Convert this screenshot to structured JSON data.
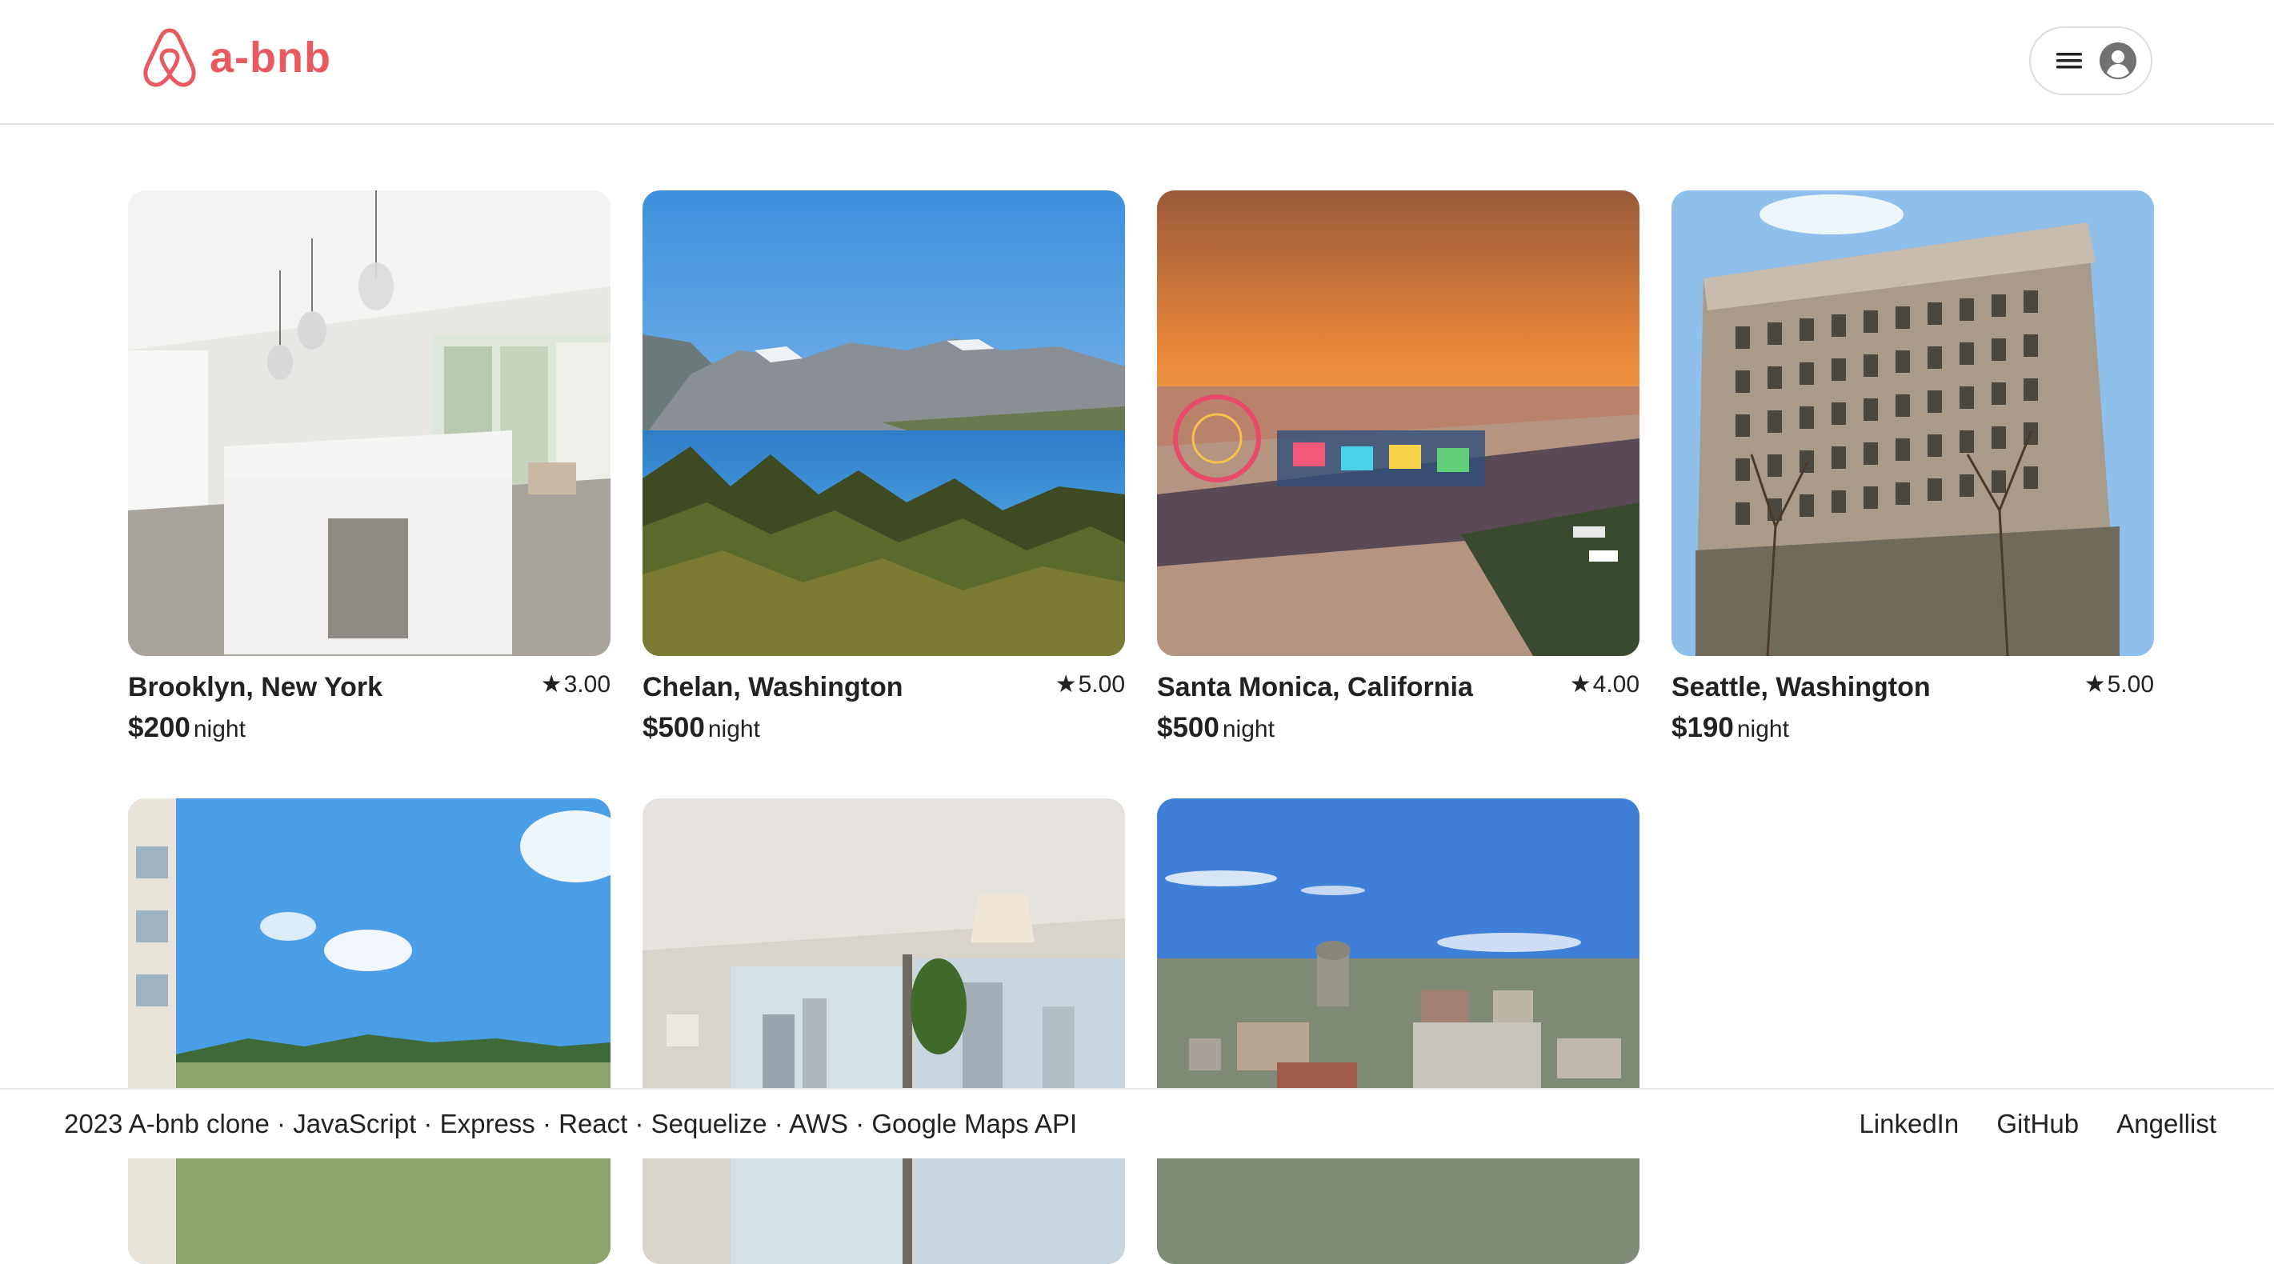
{
  "brand": {
    "name": "a-bnb",
    "color": "#e85a5f"
  },
  "header": {
    "menu_icon": "hamburger-icon",
    "avatar_icon": "user-avatar-icon"
  },
  "listings": [
    {
      "location": "Brooklyn, New York",
      "rating": "3.00",
      "price": "$200",
      "per": "night",
      "photo": "kitchen-interior"
    },
    {
      "location": "Chelan, Washington",
      "rating": "5.00",
      "price": "$500",
      "per": "night",
      "photo": "mountain-lake"
    },
    {
      "location": "Santa Monica, California",
      "rating": "4.00",
      "price": "$500",
      "per": "night",
      "photo": "pier-sunset"
    },
    {
      "location": "Seattle, Washington",
      "rating": "5.00",
      "price": "$190",
      "per": "night",
      "photo": "historic-building"
    },
    {
      "photo": "sky-trees-balcony"
    },
    {
      "photo": "apartment-window"
    },
    {
      "photo": "city-aerial"
    }
  ],
  "rating_icon": "star-icon",
  "footer": {
    "credits": "2023 A-bnb clone · JavaScript · Express · React · Sequelize · AWS · Google Maps API",
    "links": [
      "LinkedIn",
      "GitHub",
      "Angellist"
    ]
  }
}
